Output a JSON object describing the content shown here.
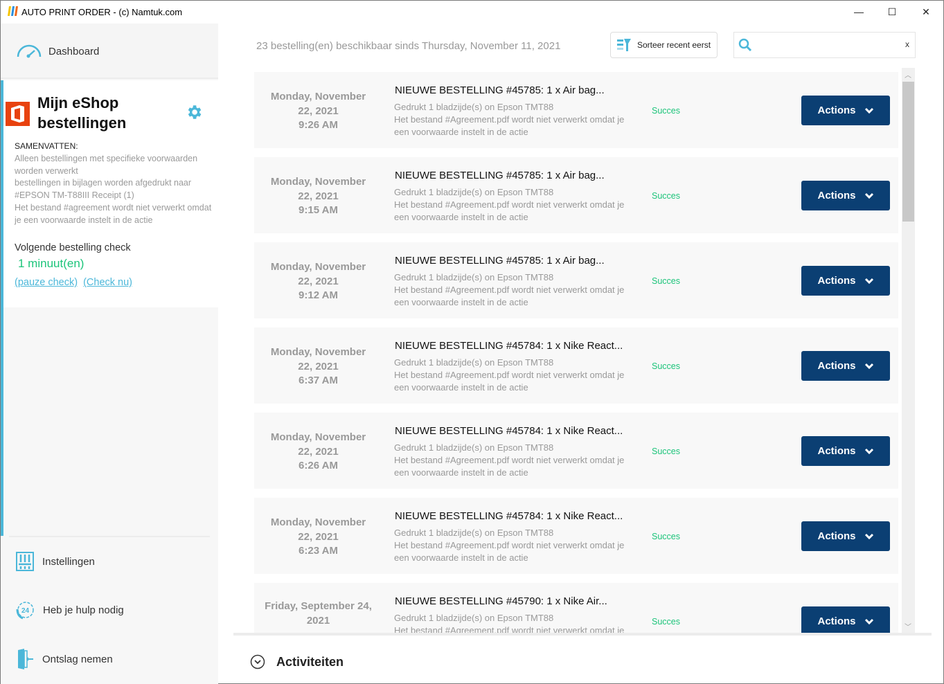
{
  "window": {
    "title": "AUTO PRINT ORDER - (c) Namtuk.com",
    "minimize": "—",
    "maximize": "☐",
    "close": "✕"
  },
  "sidebar": {
    "dashboard": "Dashboard",
    "shop_title_1": "Mijn eShop",
    "shop_title_2": "bestellingen",
    "summary_label": "SAMENVATTEN:",
    "summary_lines": [
      "Alleen bestellingen met specifieke voorwaarden worden verwerkt",
      "bestellingen in bijlagen worden afgedrukt naar #EPSON TM-T88III Receipt (1)",
      "Het bestand #agreement wordt niet verwerkt omdat je een voorwaarde instelt in de actie"
    ],
    "next_check_label": "Volgende bestelling check",
    "next_check_value": "1 minuut(en)",
    "pause_link": "(pauze check)",
    "check_now_link": "(Check nu)",
    "nav": [
      {
        "label": "Instellingen",
        "icon": "sliders-icon"
      },
      {
        "label": "Heb je hulp nodig",
        "icon": "support-24-icon"
      },
      {
        "label": "Ontslag nemen",
        "icon": "logout-door-icon"
      }
    ]
  },
  "header": {
    "count_text": "23 bestelling(en) beschikbaar sinds Thursday, November 11, 2021",
    "sort_label": "Sorteer recent eerst",
    "search_placeholder": "",
    "search_clear": "x"
  },
  "orders": [
    {
      "date1": "Monday, November",
      "date2": "22, 2021",
      "time": "9:26 AM",
      "title": "NIEUWE BESTELLING #45785: 1 x Air bag...",
      "line1": "Gedrukt 1 bladzijde(s) on Epson TMT88",
      "line2": "Het bestand #Agreement.pdf wordt niet verwerkt omdat je een voorwaarde instelt in de actie",
      "status": "Succes",
      "action": "Actions"
    },
    {
      "date1": "Monday, November",
      "date2": "22, 2021",
      "time": "9:15 AM",
      "title": "NIEUWE BESTELLING #45785: 1 x Air bag...",
      "line1": "Gedrukt 1 bladzijde(s) on Epson TMT88",
      "line2": "Het bestand #Agreement.pdf wordt niet verwerkt omdat je een voorwaarde instelt in de actie",
      "status": "Succes",
      "action": "Actions"
    },
    {
      "date1": "Monday, November",
      "date2": "22, 2021",
      "time": "9:12 AM",
      "title": "NIEUWE BESTELLING #45785: 1 x Air bag...",
      "line1": "Gedrukt 1 bladzijde(s) on Epson TMT88",
      "line2": "Het bestand #Agreement.pdf wordt niet verwerkt omdat je een voorwaarde instelt in de actie",
      "status": "Succes",
      "action": "Actions"
    },
    {
      "date1": "Monday, November",
      "date2": "22, 2021",
      "time": "6:37 AM",
      "title": "NIEUWE BESTELLING #45784: 1 x Nike React...",
      "line1": "Gedrukt 1 bladzijde(s) on Epson TMT88",
      "line2": "Het bestand #Agreement.pdf wordt niet verwerkt omdat je een voorwaarde instelt in de actie",
      "status": "Succes",
      "action": "Actions"
    },
    {
      "date1": "Monday, November",
      "date2": "22, 2021",
      "time": "6:26 AM",
      "title": "NIEUWE BESTELLING #45784: 1 x Nike React...",
      "line1": "Gedrukt 1 bladzijde(s) on Epson TMT88",
      "line2": "Het bestand #Agreement.pdf wordt niet verwerkt omdat je een voorwaarde instelt in de actie",
      "status": "Succes",
      "action": "Actions"
    },
    {
      "date1": "Monday, November",
      "date2": "22, 2021",
      "time": "6:23 AM",
      "title": "NIEUWE BESTELLING #45784: 1 x Nike React...",
      "line1": "Gedrukt 1 bladzijde(s) on Epson TMT88",
      "line2": "Het bestand #Agreement.pdf wordt niet verwerkt omdat je een voorwaarde instelt in de actie",
      "status": "Succes",
      "action": "Actions"
    },
    {
      "date1": "Friday, September 24,",
      "date2": "2021",
      "time": "",
      "title": "NIEUWE BESTELLING #45790: 1 x Nike Air...",
      "line1": "Gedrukt 1 bladzijde(s) on Epson TMT88",
      "line2": "Het bestand #Agreement.pdf wordt niet verwerkt omdat je een voorwaarde instelt in de actie",
      "status": "Succes",
      "action": "Actions"
    }
  ],
  "footer": {
    "activities": "Activiteiten"
  },
  "colors": {
    "accent": "#4bb7d9",
    "success": "#1cc47a",
    "button": "#0b3f73",
    "office": "#e8420f"
  }
}
